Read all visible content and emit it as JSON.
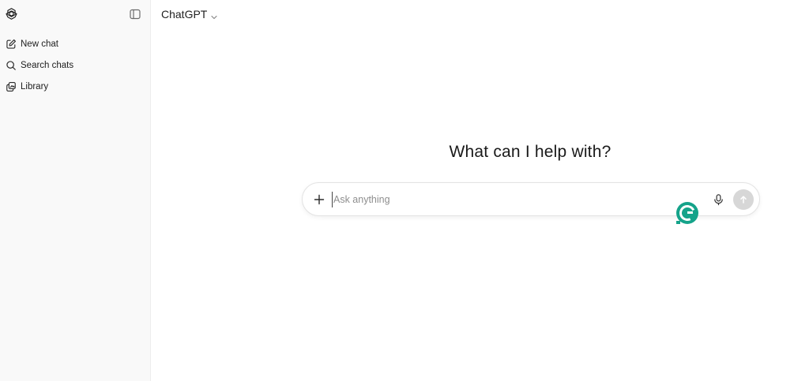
{
  "sidebar": {
    "items": [
      {
        "label": "New chat",
        "icon": "edit-icon"
      },
      {
        "label": "Search chats",
        "icon": "search-icon"
      },
      {
        "label": "Library",
        "icon": "library-icon"
      }
    ]
  },
  "header": {
    "model_name": "ChatGPT"
  },
  "main": {
    "headline": "What can I help with?",
    "composer": {
      "placeholder": "Ask anything",
      "value": ""
    }
  },
  "colors": {
    "sidebar_bg": "#f9f9f9",
    "send_button": "#d7d7d7",
    "grammarly": "#15a38a"
  }
}
